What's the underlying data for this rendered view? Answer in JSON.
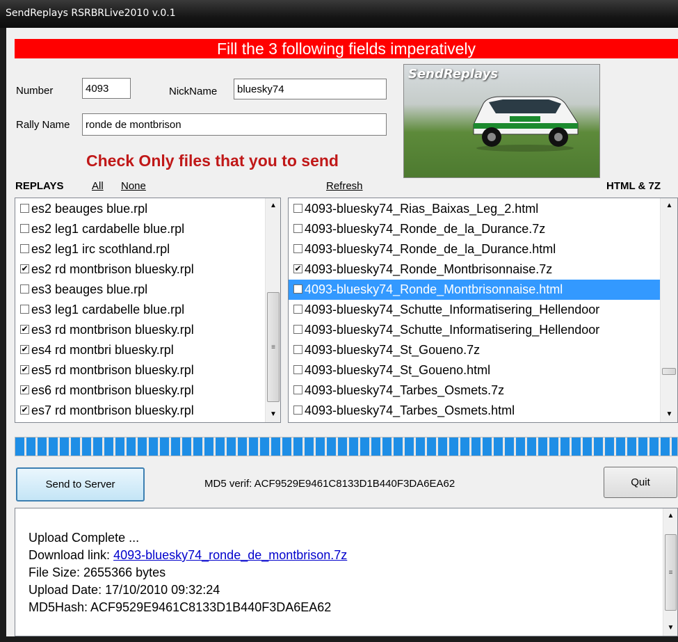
{
  "window": {
    "title": "SendReplays RSRBRLive2010 v.0.1"
  },
  "banner": {
    "text": "Fill the 3 following fields imperatively"
  },
  "form": {
    "number_label": "Number",
    "number_value": "4093",
    "nickname_label": "NickName",
    "nickname_value": "bluesky74",
    "rally_label": "Rally Name",
    "rally_value": "ronde de montbrison"
  },
  "photo": {
    "logo_text": "SendReplays"
  },
  "check_message": "Check Only files that you to send",
  "replays": {
    "header": "REPLAYS",
    "all_label": "All",
    "none_label": "None",
    "items": [
      {
        "label": "es2 beauges blue.rpl",
        "checked": false,
        "mark": ""
      },
      {
        "label": "es2 leg1 cardabelle blue.rpl",
        "checked": false,
        "mark": ""
      },
      {
        "label": "es2 leg1 irc scothland.rpl",
        "checked": false,
        "mark": ""
      },
      {
        "label": "es2 rd montbrison bluesky.rpl",
        "checked": true,
        "mark": "✔"
      },
      {
        "label": "es3 beauges blue.rpl",
        "checked": false,
        "mark": ""
      },
      {
        "label": "es3 leg1 cardabelle blue.rpl",
        "checked": false,
        "mark": ""
      },
      {
        "label": "es3 rd montbrison bluesky.rpl",
        "checked": true,
        "mark": "✔"
      },
      {
        "label": "es4 rd montbri bluesky.rpl",
        "checked": true,
        "mark": "✔"
      },
      {
        "label": "es5 rd montbrison bluesky.rpl",
        "checked": true,
        "mark": "✔"
      },
      {
        "label": "es6 rd montbrison bluesky.rpl",
        "checked": true,
        "mark": "✔"
      },
      {
        "label": "es7 rd montbrison bluesky.rpl",
        "checked": true,
        "mark": "✔"
      }
    ]
  },
  "files": {
    "refresh_label": "Refresh",
    "header": "HTML & 7Z",
    "items": [
      {
        "label": "4093-bluesky74_Rias_Baixas_Leg_2.html",
        "checked": false,
        "mark": ""
      },
      {
        "label": "4093-bluesky74_Ronde_de_la_Durance.7z",
        "checked": false,
        "mark": ""
      },
      {
        "label": "4093-bluesky74_Ronde_de_la_Durance.html",
        "checked": false,
        "mark": ""
      },
      {
        "label": "4093-bluesky74_Ronde_Montbrisonnaise.7z",
        "checked": true,
        "mark": "✔"
      },
      {
        "label": "4093-bluesky74_Ronde_Montbrisonnaise.html",
        "checked": true,
        "mark": "✔",
        "selected": true
      },
      {
        "label": "4093-bluesky74_Schutte_Informatisering_Hellendoor",
        "checked": false,
        "mark": ""
      },
      {
        "label": "4093-bluesky74_Schutte_Informatisering_Hellendoor",
        "checked": false,
        "mark": ""
      },
      {
        "label": "4093-bluesky74_St_Goueno.7z",
        "checked": false,
        "mark": ""
      },
      {
        "label": "4093-bluesky74_St_Goueno.html",
        "checked": false,
        "mark": ""
      },
      {
        "label": "4093-bluesky74_Tarbes_Osmets.7z",
        "checked": false,
        "mark": ""
      },
      {
        "label": "4093-bluesky74_Tarbes_Osmets.html",
        "checked": false,
        "mark": ""
      }
    ]
  },
  "progress": {
    "fraction": 1.0
  },
  "actions": {
    "send_label": "Send to Server",
    "md5_text": "MD5 verif: ACF9529E9461C8133D1B440F3DA6EA62",
    "quit_label": "Quit"
  },
  "log": {
    "line1": "Upload Complete ...",
    "download_prefix": "Download link: ",
    "download_link": "4093-bluesky74_ronde_de_montbrison.7z",
    "line3": "File Size: 2655366 bytes",
    "line4": "Upload Date: 17/10/2010 09:32:24",
    "line5": "MD5Hash: ACF9529E9461C8133D1B440F3DA6EA62"
  },
  "icons": {
    "scroll_up": "scroll-up-arrow-icon",
    "scroll_down": "scroll-down-arrow-icon",
    "checkmark": "checkmark-icon"
  },
  "colors": {
    "banner": "#ff0000",
    "check_message": "#c01818",
    "selection": "#3399ff",
    "progress": "#1e8ee6",
    "link": "#0000cc"
  }
}
